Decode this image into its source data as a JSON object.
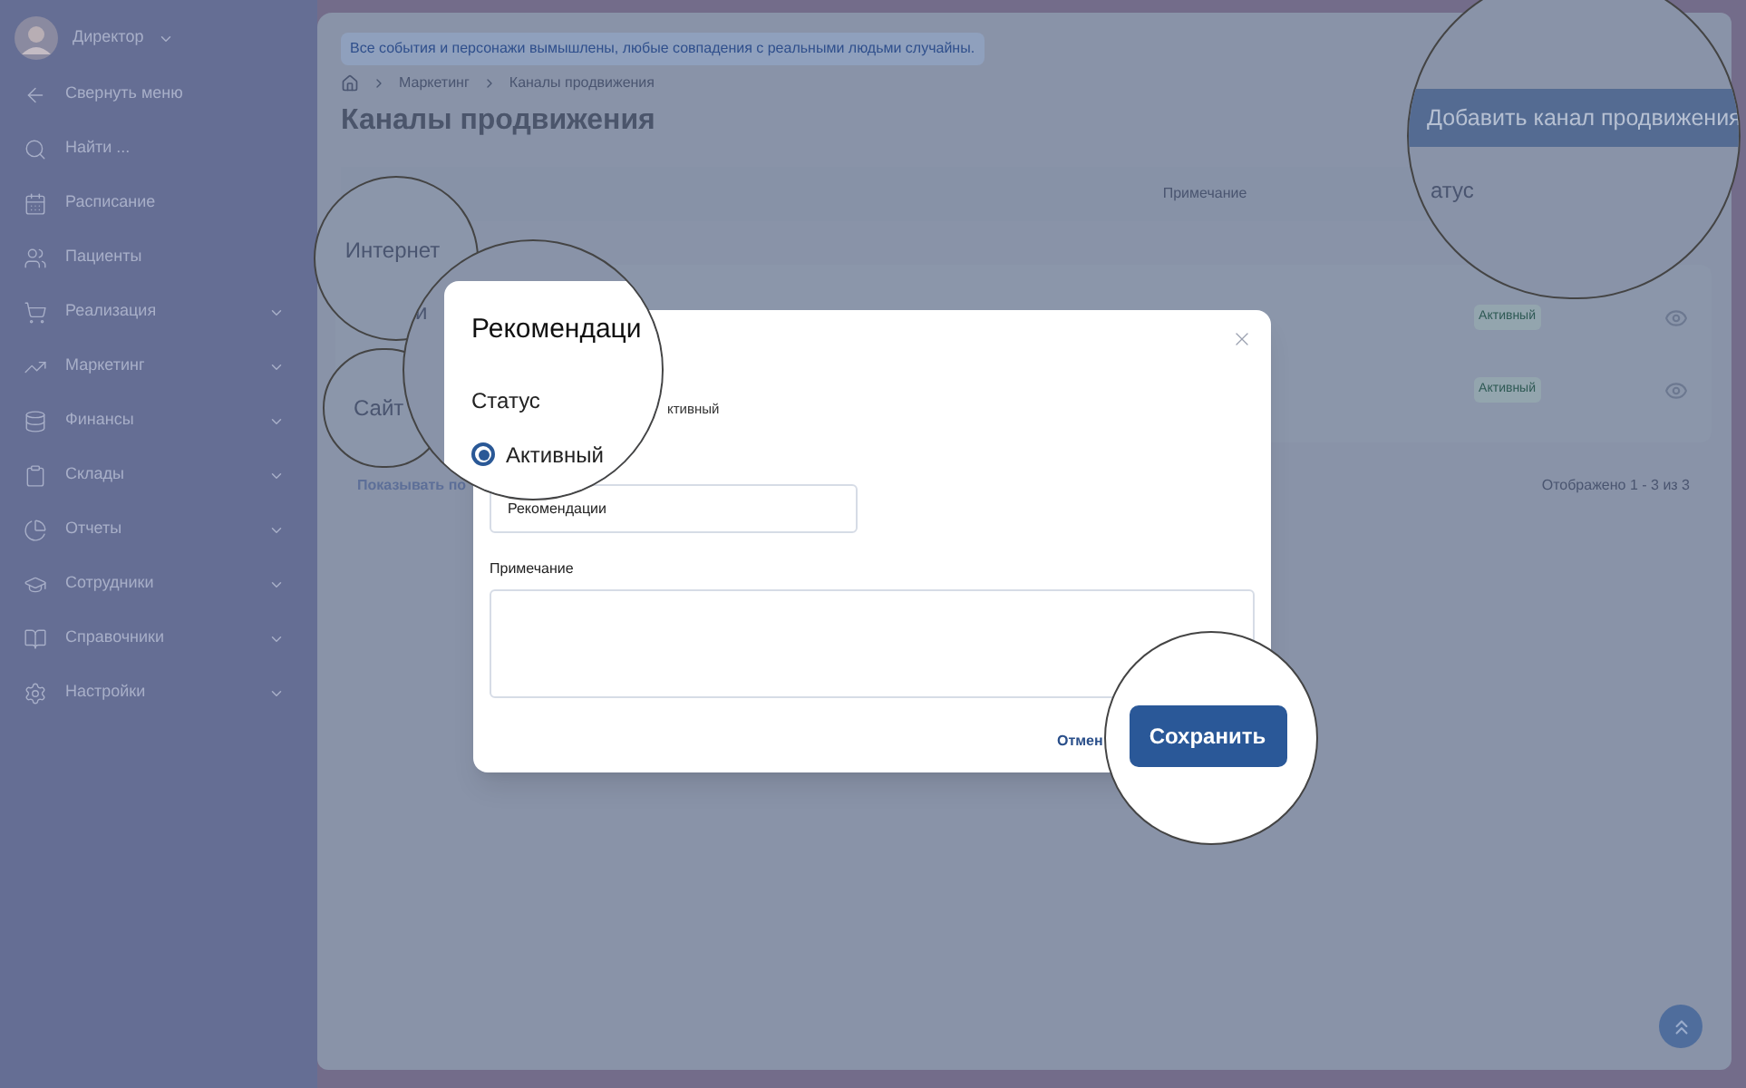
{
  "sidebar": {
    "user": "Директор",
    "items": [
      {
        "label": "Свернуть меню",
        "expandable": false
      },
      {
        "label": "Найти ...",
        "expandable": false
      },
      {
        "label": "Расписание",
        "expandable": false
      },
      {
        "label": "Пациенты",
        "expandable": false
      },
      {
        "label": "Реализация",
        "expandable": true
      },
      {
        "label": "Маркетинг",
        "expandable": true
      },
      {
        "label": "Финансы",
        "expandable": true
      },
      {
        "label": "Склады",
        "expandable": true
      },
      {
        "label": "Отчеты",
        "expandable": true
      },
      {
        "label": "Сотрудники",
        "expandable": true
      },
      {
        "label": "Справочники",
        "expandable": true
      },
      {
        "label": "Настройки",
        "expandable": true
      }
    ]
  },
  "notice": "Все события и персонажи вымышлены, любые совпадения с реальными людьми случайны.",
  "breadcrumb": [
    "Маркетинг",
    "Каналы продвижения"
  ],
  "page_title": "Каналы продвижения",
  "table": {
    "note_header": "Примечание",
    "rows": [
      {
        "status": "Активный"
      },
      {
        "status": "Активный"
      }
    ]
  },
  "pagination": {
    "page_size_label": "Показывать по",
    "range": "Отображено 1 - 3 из 3"
  },
  "modal": {
    "status_option": "ктивный",
    "name_value": "Рекомендации",
    "note_label": "Примечание",
    "cancel": "Отмен"
  },
  "zoom_internet": {
    "text": "Интернет"
  },
  "zoom_site": {
    "text": "Сайт"
  },
  "zoom_modal": {
    "row_text": "и",
    "title": "Рекомендаци",
    "status_label": "Статус",
    "option": "Активный",
    "selected": true
  },
  "zoom_add": {
    "button": "Добавить канал продвижения",
    "column": "атус"
  },
  "zoom_save": {
    "button": "Сохранить"
  }
}
